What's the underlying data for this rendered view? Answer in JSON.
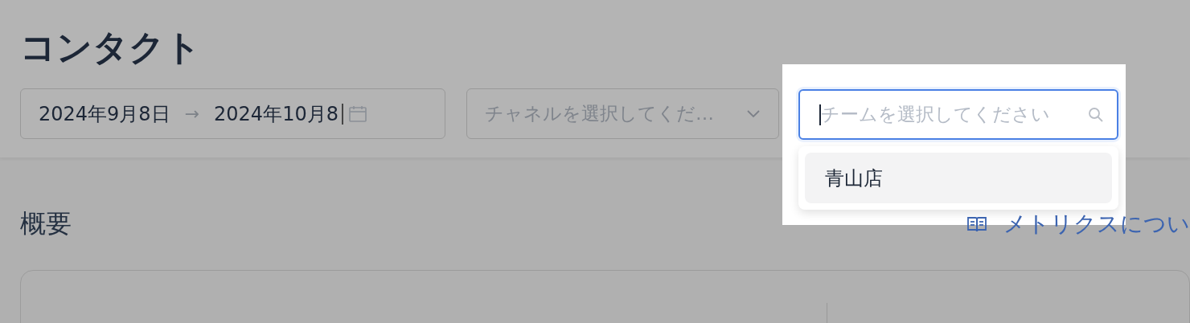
{
  "page": {
    "title": "コンタクト"
  },
  "filters": {
    "date_range": {
      "start": "2024年9月8日",
      "separator": "→",
      "end": "2024年10月8"
    },
    "channel": {
      "placeholder": "チャネルを選択してくだ…"
    },
    "team": {
      "placeholder": "チームを選択してください",
      "focused": true,
      "options": [
        {
          "label": "青山店",
          "active": true
        }
      ]
    }
  },
  "overview": {
    "title": "概要",
    "link": "メトリクスについ"
  }
}
